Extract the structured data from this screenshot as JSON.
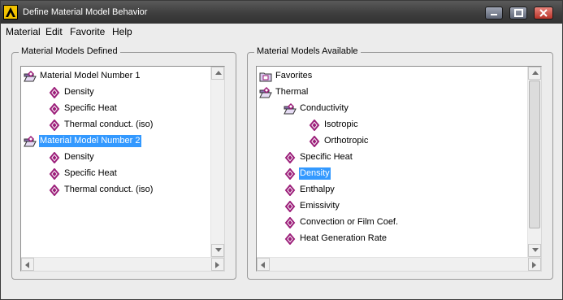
{
  "window": {
    "title": "Define Material Model Behavior"
  },
  "menu": {
    "items": [
      "Material",
      "Edit",
      "Favorite",
      "Help"
    ]
  },
  "defined": {
    "label": "Material Models Defined",
    "nodes": [
      {
        "label": "Material Model Number 1",
        "icon": "folder-open-icon",
        "indent": 0,
        "selected": false
      },
      {
        "label": "Density",
        "icon": "material-property-icon",
        "indent": 1,
        "selected": false
      },
      {
        "label": "Specific Heat",
        "icon": "material-property-icon",
        "indent": 1,
        "selected": false
      },
      {
        "label": "Thermal conduct. (iso)",
        "icon": "material-property-icon",
        "indent": 1,
        "selected": false
      },
      {
        "label": "Material Model Number 2",
        "icon": "folder-open-icon",
        "indent": 0,
        "selected": true
      },
      {
        "label": "Density",
        "icon": "material-property-icon",
        "indent": 1,
        "selected": false
      },
      {
        "label": "Specific Heat",
        "icon": "material-property-icon",
        "indent": 1,
        "selected": false
      },
      {
        "label": "Thermal conduct. (iso)",
        "icon": "material-property-icon",
        "indent": 1,
        "selected": false
      }
    ]
  },
  "available": {
    "label": "Material Models Available",
    "nodes": [
      {
        "label": "Favorites",
        "icon": "folder-closed-icon",
        "indent": 0,
        "selected": false
      },
      {
        "label": "Thermal",
        "icon": "folder-open-icon",
        "indent": 0,
        "selected": false
      },
      {
        "label": "Conductivity",
        "icon": "folder-open-icon",
        "indent": 1,
        "selected": false
      },
      {
        "label": "Isotropic",
        "icon": "material-property-icon",
        "indent": 2,
        "selected": false
      },
      {
        "label": "Orthotropic",
        "icon": "material-property-icon",
        "indent": 2,
        "selected": false
      },
      {
        "label": "Specific Heat",
        "icon": "material-property-icon",
        "indent": 1,
        "selected": false
      },
      {
        "label": "Density",
        "icon": "material-property-icon",
        "indent": 1,
        "selected": true
      },
      {
        "label": "Enthalpy",
        "icon": "material-property-icon",
        "indent": 1,
        "selected": false
      },
      {
        "label": "Emissivity",
        "icon": "material-property-icon",
        "indent": 1,
        "selected": false
      },
      {
        "label": "Convection or Film Coef.",
        "icon": "material-property-icon",
        "indent": 1,
        "selected": false
      },
      {
        "label": "Heat Generation Rate",
        "icon": "material-property-icon",
        "indent": 1,
        "selected": false
      }
    ]
  },
  "colors": {
    "selection": "#3399ff",
    "property_icon": "#9c1f7a",
    "folder": "#8a6fb0"
  }
}
